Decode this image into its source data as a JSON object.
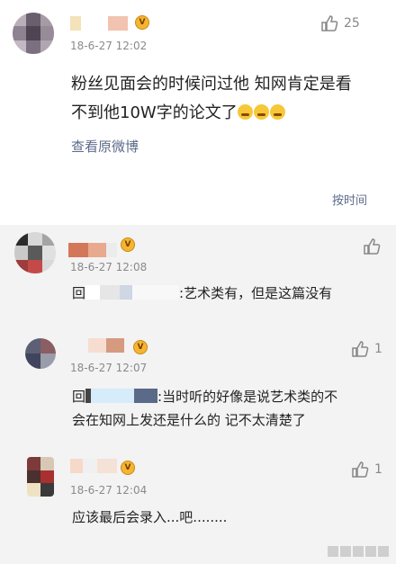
{
  "main_post": {
    "timestamp": "18-6-27 12:02",
    "like_count": "25",
    "text_line1": "粉丝见面会的时候问过他 知网肯定是看",
    "text_line2": "不到他10W字的论文了",
    "view_original": "查看原微博",
    "sort_label": "按时间"
  },
  "replies": [
    {
      "timestamp": "18-6-27 12:08",
      "like_count": "",
      "prefix": "回",
      "text": ":艺术类有，但是这篇没有"
    },
    {
      "timestamp": "18-6-27 12:07",
      "like_count": "1",
      "prefix": "回",
      "text_line1": ":当时听的好像是说艺术类的不",
      "text_line2": "会在知网上发还是什么的 记不太清楚了"
    },
    {
      "timestamp": "18-6-27 12:04",
      "like_count": "1",
      "text": "应该最后会录入...吧........"
    }
  ],
  "icons": {
    "like": "thumbs-up-icon",
    "badge": "vip-badge-icon",
    "emoji": "crying-emoji-icon"
  },
  "colors": {
    "link": "#5d6b8a",
    "background": "#f3f3f3",
    "badge": "#f5b531"
  }
}
